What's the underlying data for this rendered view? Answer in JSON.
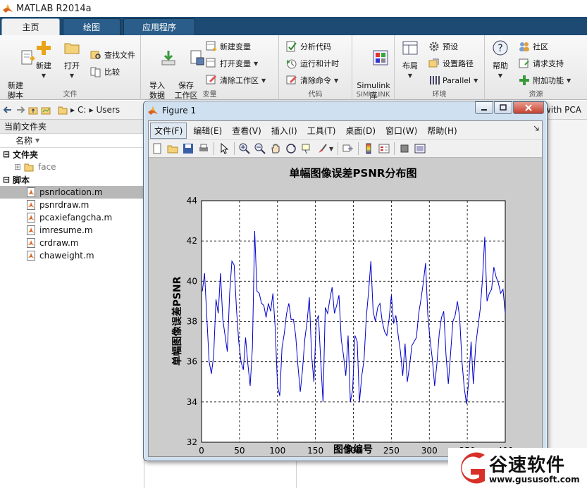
{
  "app": {
    "title": "MATLAB R2014a"
  },
  "tabs": [
    {
      "label": "主页",
      "active": true
    },
    {
      "label": "绘图",
      "active": false
    },
    {
      "label": "应用程序",
      "active": false
    }
  ],
  "ribbon": {
    "file": {
      "new_script": "新建\n脚本",
      "new": "新建",
      "open": "打开",
      "find_files": "查找文件",
      "compare": "比较",
      "label": "文件"
    },
    "variable": {
      "import": "导入\n数据",
      "save_ws": "保存\n工作区",
      "new_var": "新建变量",
      "open_var": "打开变量",
      "clear_ws": "清除工作区",
      "label": "变量"
    },
    "code": {
      "analyze": "分析代码",
      "run_time": "运行和计时",
      "clear_cmd": "清除命令",
      "label": "代码"
    },
    "simulink": {
      "lib": "Simulink\n库",
      "label": "SIMULINK"
    },
    "env": {
      "layout": "布局",
      "prefs": "预设",
      "set_path": "设置路径",
      "parallel": "Parallel",
      "label": "环境"
    },
    "resources": {
      "help": "帮助",
      "community": "社区",
      "request_support": "请求支持",
      "addons": "附加功能",
      "label": "资源"
    }
  },
  "address": {
    "crumbs": [
      "C:",
      "Users"
    ],
    "right_text": "with PCA"
  },
  "file_browser": {
    "title": "当前文件夹",
    "col_name": "名称",
    "cat_folder": "文件夹",
    "folders": [
      "face"
    ],
    "cat_script": "脚本",
    "scripts": [
      "psnrlocation.m",
      "psnrdraw.m",
      "pcaxiefangcha.m",
      "imresume.m",
      "crdraw.m",
      "chaweight.m"
    ],
    "selected": "psnrlocation.m"
  },
  "figure": {
    "title": "Figure 1",
    "menus": [
      "文件(F)",
      "编辑(E)",
      "查看(V)",
      "插入(I)",
      "工具(T)",
      "桌面(D)",
      "窗口(W)",
      "帮助(H)"
    ]
  },
  "chart_data": {
    "type": "line",
    "title": "单幅图像误差PSNR分布图",
    "xlabel": "图像编号",
    "ylabel": "单幅图像误差PSNR",
    "xlim": [
      0,
      400
    ],
    "ylim": [
      32,
      44
    ],
    "xticks": [
      0,
      50,
      100,
      150,
      200,
      250,
      300,
      350,
      400
    ],
    "yticks": [
      32,
      34,
      36,
      38,
      40,
      42,
      44
    ],
    "grid": true,
    "series": [
      {
        "color": "#0000cc",
        "x": [
          1,
          4,
          7,
          10,
          13,
          16,
          19,
          22,
          25,
          28,
          31,
          34,
          37,
          40,
          43,
          46,
          49,
          52,
          55,
          58,
          61,
          64,
          67,
          70,
          73,
          76,
          79,
          82,
          85,
          88,
          91,
          94,
          97,
          100,
          103,
          106,
          109,
          112,
          115,
          118,
          121,
          124,
          127,
          130,
          133,
          136,
          139,
          142,
          145,
          148,
          151,
          154,
          157,
          160,
          163,
          166,
          169,
          172,
          175,
          178,
          181,
          184,
          187,
          190,
          193,
          196,
          199,
          202,
          205,
          208,
          211,
          214,
          217,
          220,
          223,
          226,
          229,
          232,
          235,
          238,
          241,
          244,
          247,
          250,
          253,
          256,
          259,
          262,
          265,
          268,
          271,
          274,
          277,
          280,
          283,
          286,
          289,
          292,
          295,
          298,
          301,
          304,
          307,
          310,
          313,
          316,
          319,
          322,
          325,
          328,
          331,
          334,
          337,
          340,
          343,
          346,
          349,
          352,
          355,
          358,
          361,
          364,
          367,
          370,
          373,
          376,
          379,
          382,
          385,
          388,
          391,
          394,
          397,
          400
        ],
        "y": [
          39.5,
          40.4,
          38.2,
          36.0,
          35.4,
          36.3,
          39.1,
          38.4,
          40.4,
          38.1,
          37.3,
          36.5,
          39.4,
          41.0,
          40.8,
          38.6,
          37.0,
          36.0,
          35.6,
          37.2,
          35.9,
          34.8,
          36.7,
          42.5,
          39.5,
          39.4,
          38.9,
          38.8,
          38.2,
          38.9,
          38.5,
          39.4,
          37.7,
          34.8,
          34.3,
          36.7,
          37.4,
          38.4,
          38.9,
          38.1,
          38.1,
          37.3,
          35.8,
          34.5,
          35.6,
          37.1,
          38.0,
          39.2,
          36.3,
          35.0,
          38.0,
          38.3,
          36.0,
          34.0,
          38.7,
          38.4,
          39.1,
          39.7,
          38.4,
          38.8,
          39.3,
          37.1,
          36.3,
          35.3,
          37.3,
          34.0,
          34.6,
          37.3,
          37.0,
          34.0,
          35.3,
          36.1,
          38.2,
          39.5,
          41.0,
          38.5,
          38.0,
          38.7,
          38.9,
          38.0,
          37.5,
          37.3,
          38.1,
          39.3,
          37.9,
          38.3,
          37.3,
          36.5,
          35.3,
          36.9,
          35.0,
          35.8,
          36.8,
          37.0,
          37.2,
          38.4,
          39.1,
          39.9,
          40.9,
          38.3,
          37.1,
          36.1,
          34.8,
          35.9,
          37.4,
          38.2,
          38.5,
          36.3,
          34.9,
          36.4,
          38.0,
          38.3,
          39.0,
          38.2,
          36.0,
          34.7,
          33.9,
          35.1,
          37.0,
          34.9,
          36.8,
          37.7,
          38.6,
          40.1,
          42.2,
          39.0,
          39.4,
          39.6,
          40.7,
          40.2,
          39.9,
          39.4,
          39.6,
          38.4
        ]
      }
    ]
  },
  "watermark": {
    "brand": "谷速软件",
    "url": "www.gususoft.com"
  }
}
